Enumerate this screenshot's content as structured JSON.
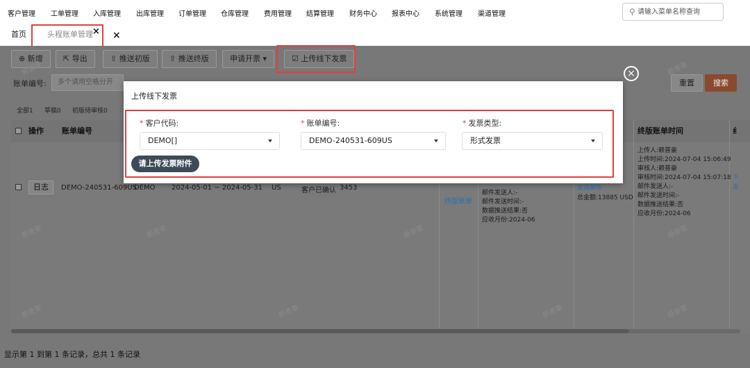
{
  "nav": {
    "items": [
      "客户管理",
      "工单管理",
      "入库管理",
      "出库管理",
      "订单管理",
      "仓库管理",
      "费用管理",
      "结算管理",
      "财务中心",
      "报表中心",
      "系统管理",
      "渠道管理"
    ],
    "search_placeholder": "请输入菜单名称查询"
  },
  "tabs": {
    "home": "首页",
    "active": "头程账单管理",
    "active_close": "×",
    "close_all": "×"
  },
  "toolbar": {
    "add": "新增",
    "export": "导出",
    "push_initial": "推送初版",
    "push_final": "推送终版",
    "invoice": "申请开票",
    "upload_offline": "上传线下发票"
  },
  "filters": {
    "bill_no_label": "账单编号:",
    "bill_no_placeholder": "多个请用空格分开",
    "reset": "重置",
    "search": "搜索"
  },
  "status_chips": [
    "全部1",
    "草稿0",
    "初版待审核0"
  ],
  "table": {
    "headers": {
      "op": "操作",
      "bill_no": "账单编号",
      "final_time": "终版账单时间"
    },
    "row": {
      "log_button": "日志",
      "bill_no": "DEMO-240531-609US",
      "customer": "DEMO",
      "period": "2024-05-01 ~ 2024-05-31",
      "country": "US",
      "status": "客户已确认",
      "number": "3453",
      "final_link": "终版账单",
      "mid_lines": [
        "邮件发送人:-",
        "邮件发送时间:-",
        "数据推送结果:否",
        "应收月份:2024-06"
      ],
      "send_mail": "发送邮件",
      "total": "总金额:13885 USD",
      "final_lines": [
        "上传人:赖普豪",
        "上传时间:2024-07-04 15:06:49",
        "审核人:赖普豪",
        "审核时间:2024-07-04 15:07:18",
        "邮件发送人:-",
        "邮件发送时间:-",
        "数据推送结果:否",
        "应收月份:2024-06"
      ],
      "edge_link": "下",
      "edge_link2": "发"
    }
  },
  "footer": "显示第 1 到第 1 条记录，总共 1 条记录",
  "dialog": {
    "title": "上传线下发票",
    "required_mark": "*",
    "customer_code_label": "客户代码:",
    "customer_code_value": "DEMO[]",
    "bill_no_label": "账单编号:",
    "bill_no_value": "DEMO-240531-609US",
    "invoice_type_label": "发票类型:",
    "invoice_type_value": "形式发票",
    "upload_button": "请上传发票附件",
    "close": "×"
  },
  "watermark": "赖普豪",
  "colors": {
    "highlight": "#e53e3e",
    "search_btn": "#e0642c",
    "upload_btn": "#3d4a58"
  }
}
